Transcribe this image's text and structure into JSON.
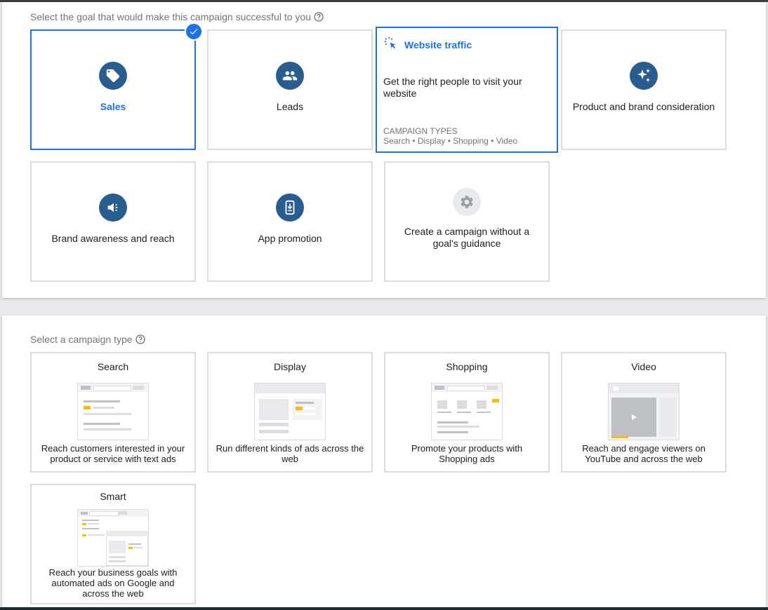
{
  "goal_section": {
    "label": "Select the goal that would make this campaign successful to you",
    "help_icon": "help-circle-icon",
    "goals": [
      {
        "label": "Sales",
        "icon": "tag-icon",
        "selected": true
      },
      {
        "label": "Leads",
        "icon": "people-icon"
      },
      {
        "label": "Website traffic",
        "icon": "cursor-click-icon",
        "description": "Get the right people to visit your website",
        "campaign_types_label": "CAMPAIGN TYPES",
        "campaign_types": "Search • Display • Shopping • Video"
      },
      {
        "label": "Product and brand consideration",
        "icon": "sparkle-icon"
      },
      {
        "label": "Brand awareness and reach",
        "icon": "megaphone-icon"
      },
      {
        "label": "App promotion",
        "icon": "phone-download-icon"
      },
      {
        "label": "Create a campaign without a goal's guidance",
        "icon": "gear-icon"
      }
    ]
  },
  "type_section": {
    "label": "Select a campaign type",
    "help_icon": "help-circle-icon",
    "types": [
      {
        "title": "Search",
        "description": "Reach customers interested in your product or service with text ads"
      },
      {
        "title": "Display",
        "description": "Run different kinds of ads across the web"
      },
      {
        "title": "Shopping",
        "description": "Promote your products with Shopping ads"
      },
      {
        "title": "Video",
        "description": "Reach and engage viewers on YouTube and across the web"
      },
      {
        "title": "Smart",
        "description": "Reach your business goals with automated ads on Google and across the web"
      }
    ]
  },
  "colors": {
    "accent": "#1a73e8",
    "icon_bg": "#2a5d8f",
    "highlight": "#fbbc04",
    "border": "#dadce0"
  }
}
